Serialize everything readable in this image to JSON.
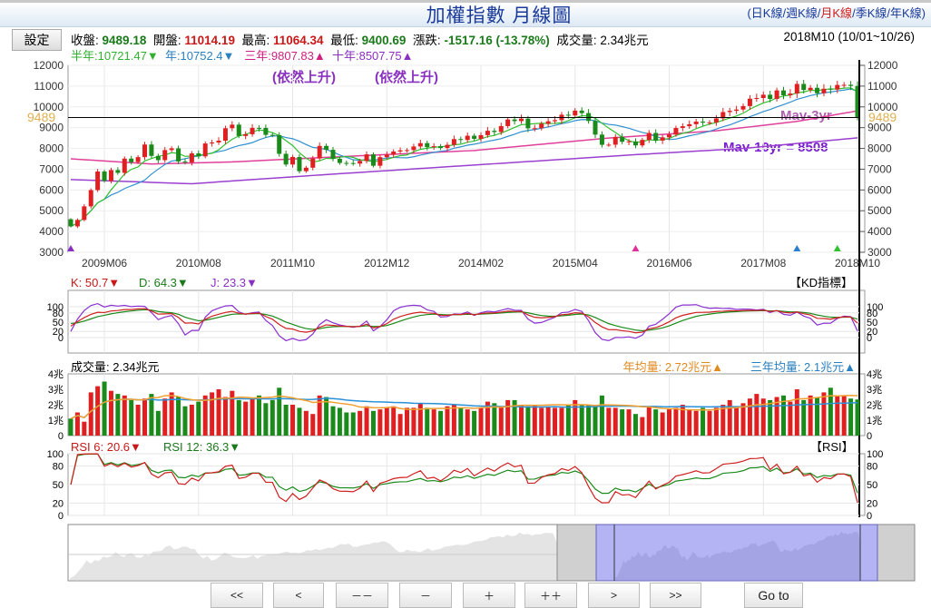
{
  "header": {
    "title": "加權指數  月線圖",
    "links": [
      "日K線",
      "週K線",
      "月K線",
      "季K線",
      "年K線"
    ],
    "active_link": 2
  },
  "settings_button": "設定",
  "info": {
    "close_label": "收盤:",
    "close": "9489.18",
    "open_label": "開盤:",
    "open": "11014.19",
    "high_label": "最高:",
    "high": "11064.34",
    "low_label": "最低:",
    "low": "9400.69",
    "change_label": "漲跌:",
    "change": "-1517.16",
    "change_pct": "(-13.78%)",
    "volume_label": "成交量:",
    "volume": "2.34兆元",
    "period": "2018M10 (10/01~10/26)"
  },
  "ma_legend": {
    "half_year": "半年:10721.47▼",
    "year": "年:10752.4▼",
    "three_year": "三年:9807.83▲",
    "ten_year": "十年:8507.75▲"
  },
  "annotations": {
    "rising1": "(依然上升)",
    "rising2": "(依然上升)",
    "mav3": "Mav-3yr",
    "mav10": "Mav-10yr = 8508",
    "price_tag": "9489"
  },
  "kd_legend": {
    "k": "K: 50.7▼",
    "d": "D: 64.3▼",
    "j": "J: 23.3▼",
    "title": "【KD指標】"
  },
  "vol_legend": {
    "vol": "成交量: 2.34兆元",
    "year_avg": "年均量: 2.72兆元▲",
    "three_year_avg": "三年均量: 2.1兆元▲"
  },
  "rsi_legend": {
    "rsi6": "RSI 6: 20.6▼",
    "rsi12": "RSI 12: 36.3▼",
    "title": "【RSI】"
  },
  "buttons": [
    "<<",
    "<",
    "－－",
    "－",
    "＋",
    "＋＋",
    ">",
    ">>",
    "Go to"
  ],
  "colors": {
    "up": "#e02020",
    "down": "#1a8a1a",
    "ma6": "#30c030",
    "ma12": "#3090d0",
    "ma36": "#e0409a",
    "ma120": "#9a40d0"
  },
  "chart_data": {
    "type": "candlestick",
    "start": "2009M01",
    "end": "2018M10",
    "x_labels": [
      "2009M06",
      "2010M08",
      "2011M10",
      "2012M12",
      "2014M02",
      "2015M04",
      "2016M06",
      "2017M08",
      "2018M10"
    ],
    "x_label_index": [
      5,
      19,
      33,
      47,
      61,
      75,
      89,
      103,
      117
    ],
    "price_ticks": [
      3000,
      4000,
      5000,
      6000,
      7000,
      8000,
      9000,
      10000,
      11000,
      12000
    ],
    "price_ylim": [
      3000,
      12000
    ],
    "last_close": 9489,
    "closes": [
      4248,
      4557,
      5211,
      5993,
      6890,
      6432,
      6958,
      6825,
      7509,
      7340,
      7582,
      8188,
      7640,
      7436,
      7920,
      8004,
      7373,
      7329,
      7760,
      7616,
      8238,
      8287,
      8372,
      8972,
      9145,
      8600,
      8683,
      8989,
      8988,
      8652,
      8644,
      7741,
      7225,
      7588,
      6904,
      7072,
      7517,
      8121,
      7933,
      7501,
      7301,
      7296,
      7270,
      7397,
      7715,
      7166,
      7580,
      7699,
      7850,
      7907,
      7918,
      8093,
      8254,
      8062,
      8107,
      8021,
      8173,
      8450,
      8406,
      8611,
      8462,
      8639,
      8849,
      8791,
      9075,
      9393,
      9315,
      9436,
      8966,
      8974,
      9187,
      9307,
      9361,
      9622,
      9586,
      9820,
      9701,
      9323,
      8665,
      8174,
      8181,
      8554,
      8320,
      8338,
      8145,
      8411,
      8744,
      8377,
      8535,
      8666,
      8984,
      9068,
      9166,
      9290,
      9240,
      9253,
      9447,
      9750,
      9812,
      9872,
      10040,
      10395,
      10427,
      10585,
      10383,
      10793,
      10560,
      10642,
      11103,
      10815,
      10919,
      10657,
      10874,
      10836,
      11057,
      11063,
      11006,
      9489
    ],
    "first_open": 4591,
    "volumes": [
      1.1,
      1.5,
      0.9,
      2.8,
      3.2,
      3.5,
      2.9,
      2.7,
      2.6,
      2.3,
      2.0,
      2.4,
      2.7,
      1.6,
      2.4,
      2.8,
      2.5,
      1.9,
      2.0,
      2.2,
      2.6,
      2.8,
      3.0,
      2.5,
      2.9,
      2.3,
      2.2,
      2.4,
      2.6,
      2.1,
      2.3,
      3.1,
      2.0,
      2.0,
      1.8,
      1.6,
      1.4,
      2.6,
      2.5,
      1.9,
      1.8,
      1.5,
      1.5,
      1.6,
      1.9,
      1.6,
      1.7,
      1.8,
      1.9,
      1.4,
      1.8,
      1.8,
      2.1,
      1.8,
      1.7,
      1.6,
      1.9,
      2.0,
      1.8,
      1.7,
      1.6,
      1.8,
      2.2,
      2.1,
      1.9,
      2.3,
      2.3,
      2.0,
      1.9,
      2.0,
      1.8,
      1.9,
      1.8,
      1.8,
      2.0,
      2.3,
      2.0,
      2.0,
      1.9,
      2.6,
      1.8,
      1.8,
      1.7,
      1.7,
      1.4,
      1.2,
      1.9,
      1.7,
      1.5,
      1.7,
      1.8,
      2.0,
      1.7,
      1.6,
      1.8,
      1.6,
      1.8,
      2.0,
      2.3,
      1.9,
      2.1,
      2.4,
      2.7,
      2.4,
      2.3,
      2.5,
      2.6,
      2.2,
      3.0,
      2.3,
      2.6,
      2.5,
      2.8,
      3.1,
      2.6,
      2.6,
      2.4,
      2.34
    ],
    "volume_ticks": [
      "0",
      "1兆",
      "2兆",
      "3兆",
      "4兆"
    ],
    "ma36_keypoints": [
      [
        0,
        7500
      ],
      [
        12,
        7250
      ],
      [
        24,
        7350
      ],
      [
        40,
        7600
      ],
      [
        60,
        7900
      ],
      [
        80,
        8500
      ],
      [
        96,
        8850
      ],
      [
        108,
        9300
      ],
      [
        117,
        9808
      ]
    ],
    "ma120_keypoints": [
      [
        0,
        6500
      ],
      [
        18,
        6300
      ],
      [
        36,
        6700
      ],
      [
        60,
        7200
      ],
      [
        84,
        7700
      ],
      [
        100,
        8000
      ],
      [
        117,
        8508
      ]
    ],
    "kd_ticks": [
      0,
      20,
      50,
      80,
      100
    ],
    "rsi_ticks": [
      0,
      20,
      50,
      80,
      100
    ]
  }
}
